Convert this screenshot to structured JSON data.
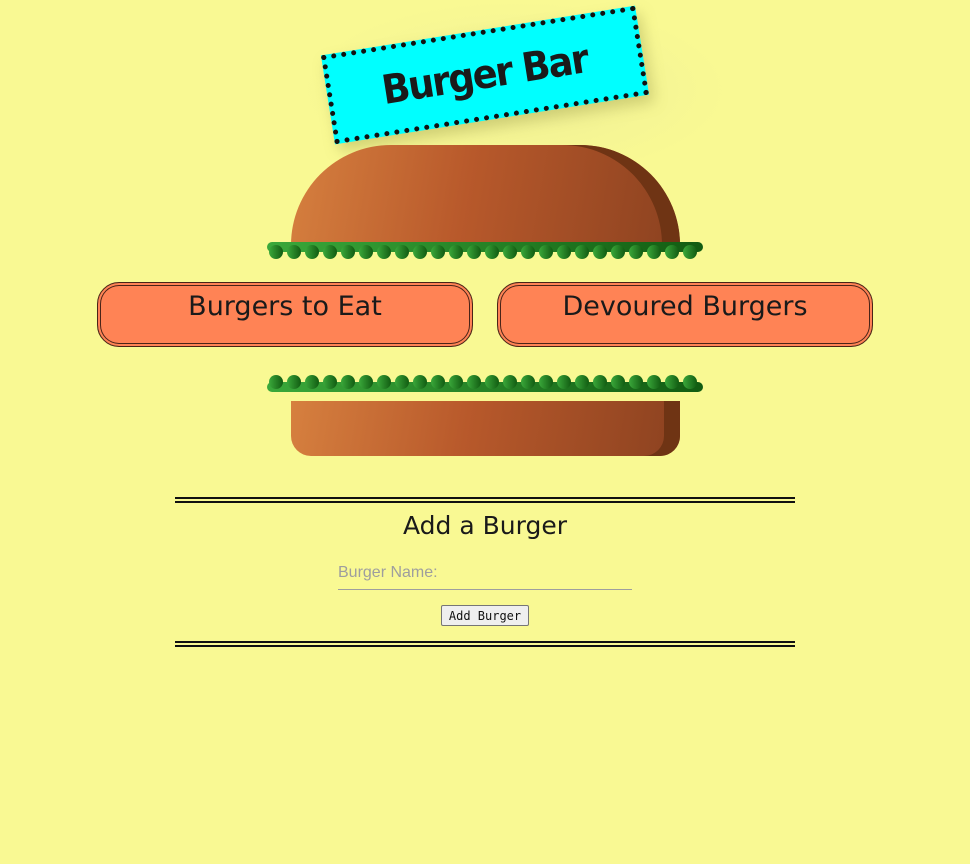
{
  "logo": {
    "text": "Burger Bar"
  },
  "categories": {
    "eat_label": "Burgers to Eat",
    "devoured_label": "Devoured Burgers"
  },
  "add_form": {
    "title": "Add a Burger",
    "name_placeholder": "Burger Name:",
    "name_value": "",
    "submit_label": "Add Burger"
  },
  "colors": {
    "background": "#f9f993",
    "sign": "#00ffff",
    "bun": "#b8592b",
    "lettuce": "#2e9a2e",
    "category_button": "#ff8355"
  },
  "icons": {
    "bun_top": "bun-top-icon",
    "lettuce": "lettuce-icon",
    "bun_bottom": "bun-bottom-icon"
  }
}
